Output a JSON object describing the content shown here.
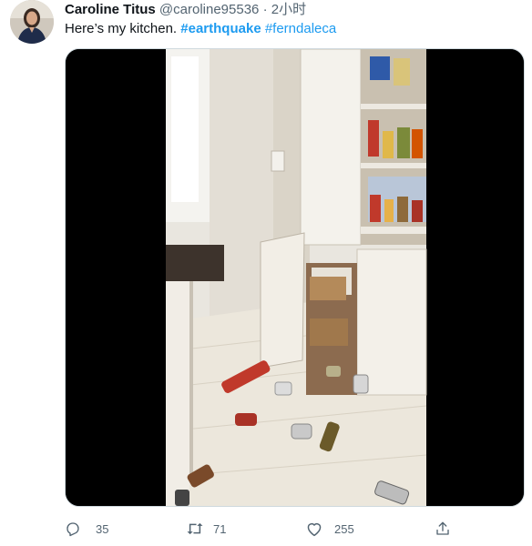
{
  "tweet": {
    "display_name": "Caroline Titus",
    "handle": "@caroline95536",
    "separator": "·",
    "time": "2小时",
    "text_prefix": "Here’s my kitchen.",
    "hashtags": [
      "#earthquake",
      "#ferndaleca"
    ]
  },
  "actions": {
    "reply_count": "35",
    "retweet_count": "71",
    "like_count": "255"
  },
  "colors": {
    "link": "#1d9bf0",
    "secondary_text": "#536471",
    "primary_text": "#0f1419"
  },
  "icons": [
    "reply-icon",
    "retweet-icon",
    "like-icon",
    "share-icon"
  ]
}
